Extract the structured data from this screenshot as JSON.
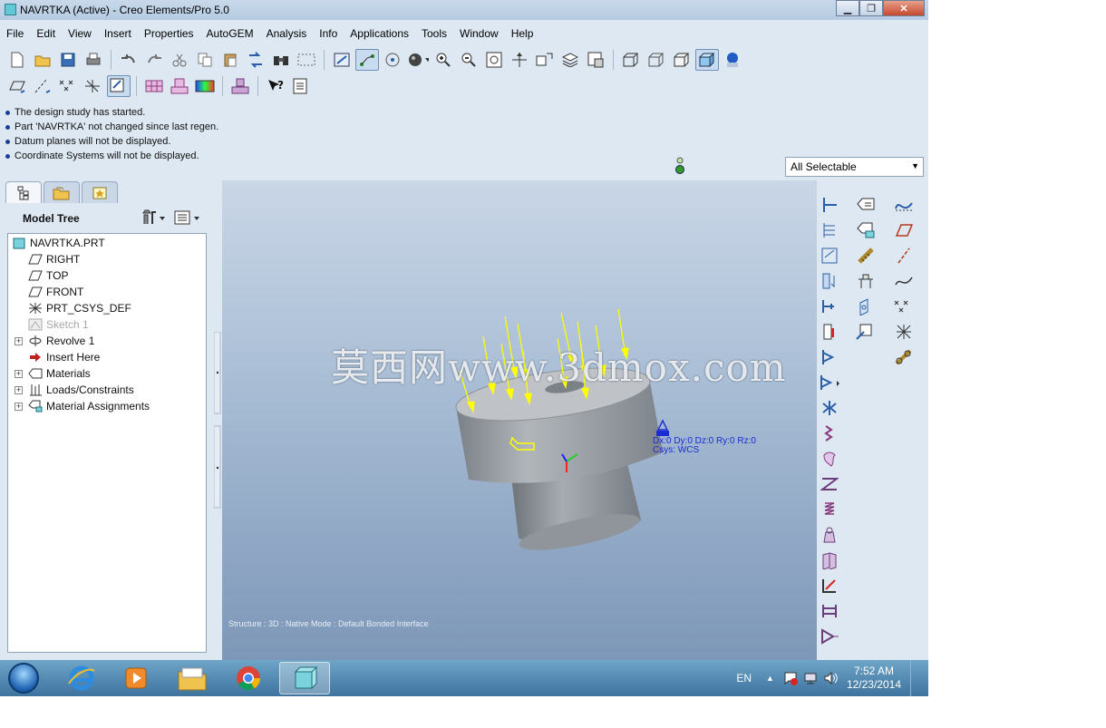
{
  "window": {
    "title": "NAVRTKA (Active) - Creo Elements/Pro 5.0"
  },
  "menu": [
    "File",
    "Edit",
    "View",
    "Insert",
    "Properties",
    "AutoGEM",
    "Analysis",
    "Info",
    "Applications",
    "Tools",
    "Window",
    "Help"
  ],
  "messages": [
    "The design study has started.",
    "Part 'NAVRTKA' not changed since last regen.",
    "Datum planes will not be displayed.",
    "Coordinate Systems will not be displayed."
  ],
  "filter": {
    "selected": "All Selectable"
  },
  "model_tree": {
    "title": "Model Tree",
    "items": [
      {
        "label": "NAVRTKA.PRT"
      },
      {
        "label": "RIGHT"
      },
      {
        "label": "TOP"
      },
      {
        "label": "FRONT"
      },
      {
        "label": "PRT_CSYS_DEF"
      },
      {
        "label": "Sketch 1"
      },
      {
        "label": "Revolve 1"
      },
      {
        "label": "Insert Here"
      },
      {
        "label": "Materials"
      },
      {
        "label": "Loads/Constraints"
      },
      {
        "label": "Material Assignments"
      }
    ]
  },
  "viewport": {
    "watermark": "莫西网www.3dmox.com",
    "constraint_label_line1": "Dx:0 Dy:0 Dz:0 Ry:0 Rz:0",
    "constraint_label_line2": "Csys: WCS",
    "status": "Structure : 3D : Native Mode : Default Bonded Interface"
  },
  "taskbar": {
    "language": "EN",
    "time": "7:52 AM",
    "date": "12/23/2014"
  },
  "colors": {
    "accent": "#1c3f9a",
    "load_arrow": "#ffff00",
    "part_gray": "#9ea4aa"
  }
}
